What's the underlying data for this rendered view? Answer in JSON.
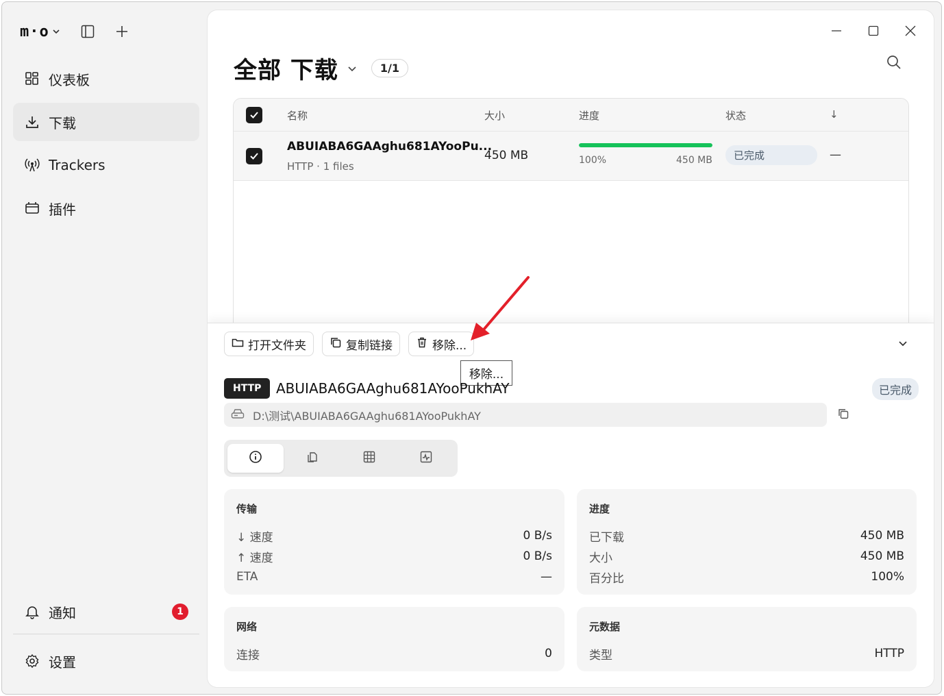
{
  "app": {
    "logo": "m·o"
  },
  "sidebar": {
    "items": [
      {
        "label": "仪表板",
        "icon": "dashboard-icon"
      },
      {
        "label": "下载",
        "icon": "download-icon",
        "active": true
      },
      {
        "label": "Trackers",
        "icon": "antenna-icon"
      },
      {
        "label": "插件",
        "icon": "plugin-icon"
      }
    ],
    "notify": {
      "label": "通知",
      "badge": "1"
    },
    "settings": {
      "label": "设置"
    }
  },
  "header": {
    "title": "全部 下载",
    "count": "1/1"
  },
  "table": {
    "columns": {
      "name": "名称",
      "size": "大小",
      "progress": "进度",
      "status": "状态",
      "sort": "↓"
    },
    "rows": [
      {
        "name": "ABUIABA6GAAghu681AYooPu...",
        "sub": "HTTP · 1 files",
        "size": "450 MB",
        "progress_pct": 100,
        "progress_label": "100%",
        "progress_size": "450 MB",
        "status": "已完成",
        "extra": "—"
      }
    ]
  },
  "toolbar": {
    "open_folder": "打开文件夹",
    "copy_link": "复制链接",
    "remove": "移除...",
    "tooltip": "移除..."
  },
  "detail": {
    "protocol": "HTTP",
    "name": "ABUIABA6GAAghu681AYooPukhAY",
    "status": "已完成",
    "path": "D:\\测试\\ABUIABA6GAAghu681AYooPukhAY",
    "tabs": [
      "info-icon",
      "files-icon",
      "grid-icon",
      "activity-icon"
    ]
  },
  "cards": {
    "transfer": {
      "title": "传输",
      "rows": [
        {
          "k": "↓ 速度",
          "v": "0 B/s"
        },
        {
          "k": "↑ 速度",
          "v": "0 B/s"
        },
        {
          "k": "ETA",
          "v": "—"
        }
      ]
    },
    "progress": {
      "title": "进度",
      "rows": [
        {
          "k": "已下载",
          "v": "450 MB"
        },
        {
          "k": "大小",
          "v": "450 MB"
        },
        {
          "k": "百分比",
          "v": "100%"
        }
      ]
    },
    "network": {
      "title": "网络",
      "rows": [
        {
          "k": "连接",
          "v": "0"
        }
      ]
    },
    "metadata": {
      "title": "元数据",
      "rows": [
        {
          "k": "类型",
          "v": "HTTP"
        }
      ]
    }
  },
  "colors": {
    "accent": "#16c25a",
    "badge": "#e11d2e",
    "arrow": "#e3202a"
  }
}
